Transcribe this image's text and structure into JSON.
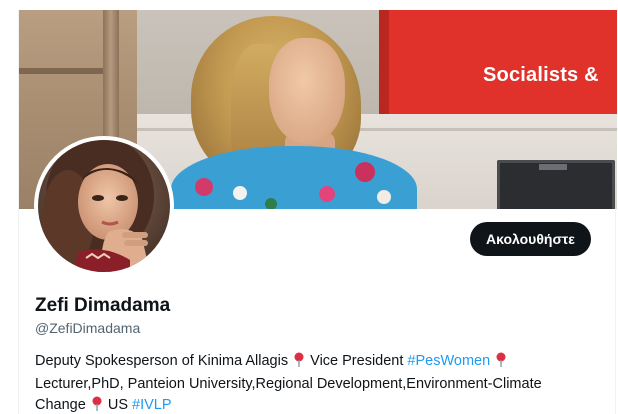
{
  "banner": {
    "sign_text": "Socialists &"
  },
  "profile": {
    "follow_label": "Ακολουθήστε",
    "name": "Zefi Dimadama",
    "handle": "@ZefiDimadama"
  },
  "bio": {
    "part1": "Deputy Spokesperson of Kinima Allagis",
    "part2": "Vice President",
    "tag1": "#PesWomen",
    "part3": "Lecturer,PhD, Panteion University,Regional Development,Environment-Climate Change",
    "part4": "US",
    "tag2": "#IVLP"
  },
  "colors": {
    "link": "#1d9bf0",
    "follow_bg": "#0f1419",
    "secondary_text": "#536471"
  },
  "icons": {
    "pin": "round-pushpin-emoji"
  }
}
